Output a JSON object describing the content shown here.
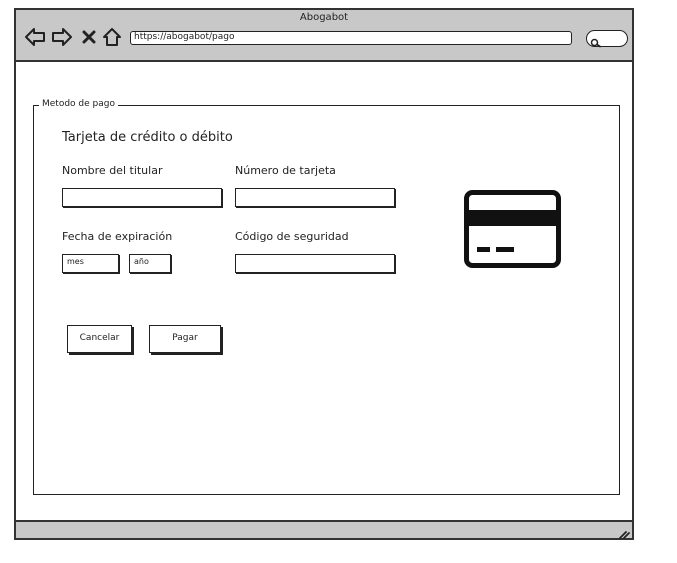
{
  "window": {
    "title": "Abogabot"
  },
  "nav": {
    "url": "https://abogabot/pago"
  },
  "form": {
    "legend": "Metodo de pago",
    "section_title": "Tarjeta de crédito o débito",
    "holder_label": "Nombre del titular",
    "card_number_label": "Número de tarjeta",
    "expiry_label": "Fecha de expiración",
    "security_label": "Código de seguridad",
    "month_value": "mes",
    "year_value": "año",
    "cancel_label": "Cancelar",
    "pay_label": "Pagar"
  },
  "icons": {
    "back": "arrow-left-icon",
    "forward": "arrow-right-icon",
    "stop": "close-icon",
    "home": "home-icon",
    "search": "search-icon",
    "card": "credit-card-icon",
    "resize": "resize-grip-icon"
  }
}
